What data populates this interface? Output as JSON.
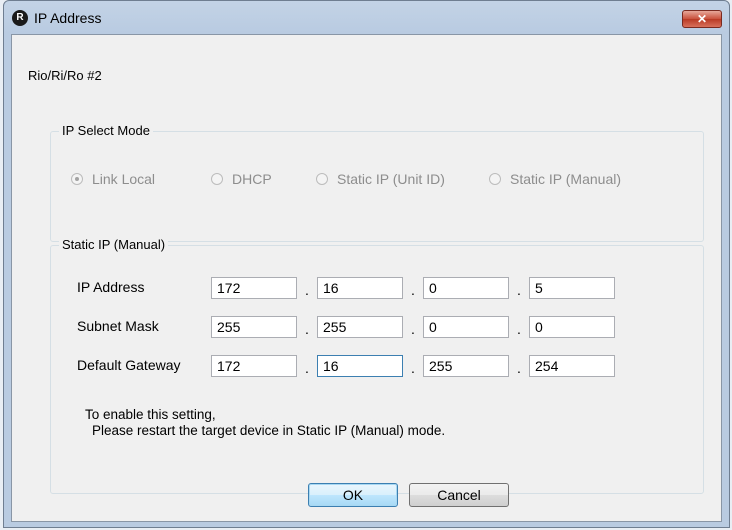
{
  "window": {
    "title": "IP Address",
    "close_glyph": "✕",
    "app_icon_glyph": "R"
  },
  "device_label": "Rio/Ri/Ro #2",
  "ip_select_mode": {
    "title": "IP Select Mode",
    "options": [
      {
        "label": "Link Local",
        "selected": true
      },
      {
        "label": "DHCP",
        "selected": false
      },
      {
        "label": "Static IP (Unit ID)",
        "selected": false
      },
      {
        "label": "Static IP (Manual)",
        "selected": false
      }
    ]
  },
  "static_ip": {
    "title": "Static IP (Manual)",
    "rows": [
      {
        "label": "IP Address",
        "octets": [
          "172",
          "16",
          "0",
          "5"
        ]
      },
      {
        "label": "Subnet Mask",
        "octets": [
          "255",
          "255",
          "0",
          "0"
        ]
      },
      {
        "label": "Default Gateway",
        "octets": [
          "172",
          "16",
          "255",
          "254"
        ]
      }
    ],
    "separator": ".",
    "note_line1": "To enable this setting,",
    "note_line2": "Please restart the target device in Static IP (Manual) mode."
  },
  "buttons": {
    "ok": "OK",
    "cancel": "Cancel"
  }
}
